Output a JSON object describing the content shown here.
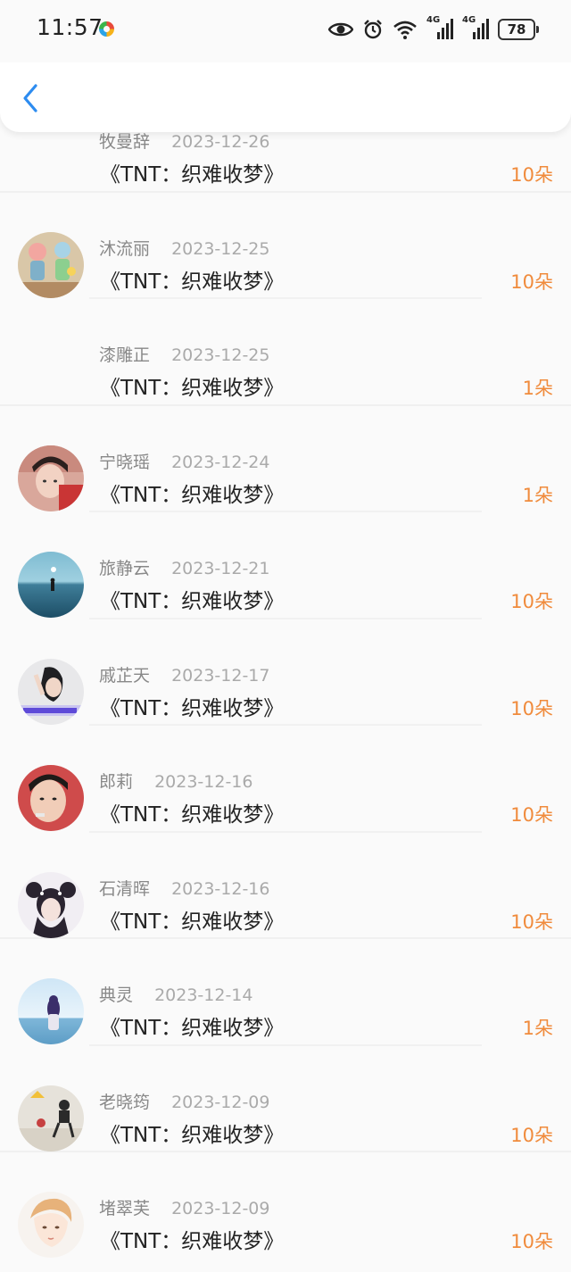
{
  "status_bar": {
    "time": "11:57",
    "network_1": "4G",
    "network_2": "4G",
    "battery": "78",
    "icons": [
      "eye-icon",
      "alarm-icon",
      "wifi-icon",
      "signal-icon",
      "signal-icon",
      "battery-icon"
    ]
  },
  "header": {
    "back_icon": "chevron-left-icon"
  },
  "colors": {
    "accent_back": "#2d8cf0",
    "amount": "#f08b3c"
  },
  "gifts": [
    {
      "name": "牧曼辞",
      "date": "2023-12-26",
      "title": "《TNT：织难收梦》",
      "amount": "10朵",
      "avatar": "none"
    },
    {
      "name": "沐流丽",
      "date": "2023-12-25",
      "title": "《TNT：织难收梦》",
      "amount": "10朵",
      "avatar": "cartoon-kids"
    },
    {
      "name": "漆雕正",
      "date": "2023-12-25",
      "title": "《TNT：织难收梦》",
      "amount": "1朵",
      "avatar": "none"
    },
    {
      "name": "宁晓瑶",
      "date": "2023-12-24",
      "title": "《TNT：织难收梦》",
      "amount": "1朵",
      "avatar": "selfie-girl"
    },
    {
      "name": "旅静云",
      "date": "2023-12-21",
      "title": "《TNT：织难收梦》",
      "amount": "10朵",
      "avatar": "sea-person"
    },
    {
      "name": "戚芷天",
      "date": "2023-12-17",
      "title": "《TNT：织难收梦》",
      "amount": "10朵",
      "avatar": "photo-caption"
    },
    {
      "name": "郎莉",
      "date": "2023-12-16",
      "title": "《TNT：织难收梦》",
      "amount": "10朵",
      "avatar": "selfie-man"
    },
    {
      "name": "石清晖",
      "date": "2023-12-16",
      "title": "《TNT：织难收梦》",
      "amount": "10朵",
      "avatar": "girl-pigtails"
    },
    {
      "name": "典灵",
      "date": "2023-12-14",
      "title": "《TNT：织难收梦》",
      "amount": "1朵",
      "avatar": "girl-sky"
    },
    {
      "name": "老晓筠",
      "date": "2023-12-09",
      "title": "《TNT：织难收梦》",
      "amount": "10朵",
      "avatar": "sketch-kid"
    },
    {
      "name": "堵翠芙",
      "date": "2023-12-09",
      "title": "《TNT：织难收梦》",
      "amount": "10朵",
      "avatar": "anime-face"
    }
  ]
}
